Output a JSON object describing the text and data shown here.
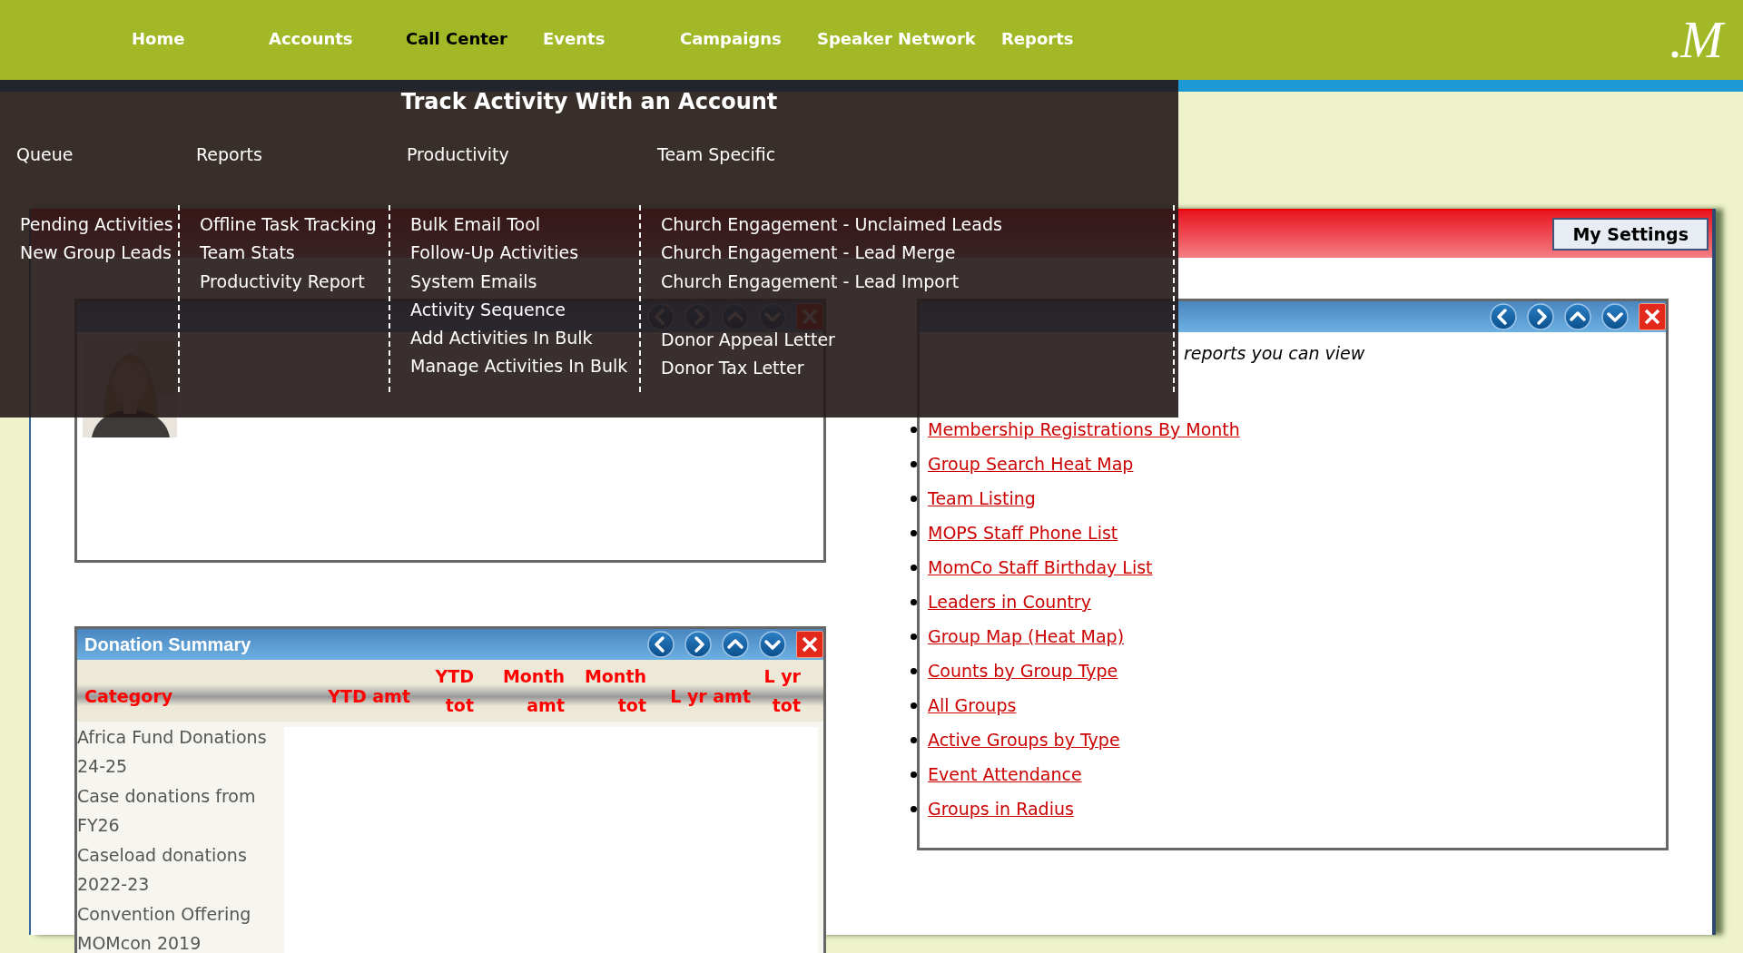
{
  "nav": {
    "items": [
      {
        "label": "Home",
        "selected": false
      },
      {
        "label": "Accounts",
        "selected": false
      },
      {
        "label": "Call Center",
        "selected": true
      },
      {
        "label": "Events",
        "selected": false
      },
      {
        "label": "Campaigns",
        "selected": false
      },
      {
        "label": "Speaker Network",
        "selected": false
      },
      {
        "label": "Reports",
        "selected": false
      }
    ],
    "logo": "M"
  },
  "menu": {
    "title": "Track Activity With an Account",
    "columns": [
      {
        "heading": "Queue",
        "groups": [
          [
            "Pending Activities",
            "New Group Leads"
          ]
        ]
      },
      {
        "heading": "Reports",
        "groups": [
          [
            "Offline Task Tracking",
            "Team Stats",
            "Productivity Report"
          ]
        ]
      },
      {
        "heading": "Productivity",
        "groups": [
          [
            "Bulk Email Tool",
            "Follow-Up Activities",
            "System Emails",
            "Activity Sequence",
            "Add Activities In Bulk",
            "Manage Activities In Bulk"
          ]
        ]
      },
      {
        "heading": "Team Specific",
        "groups": [
          [
            "Church Engagement - Unclaimed Leads",
            "Church Engagement - Lead Merge",
            "Church Engagement - Lead Import"
          ],
          [
            "Donor Appeal Letter",
            "Donor Tax Letter"
          ]
        ]
      }
    ]
  },
  "dashboard": {
    "settings_button": "My Settings"
  },
  "report_list": {
    "available_note": "reports you can view",
    "reports": [
      "Membership Registrations By Month",
      "Group Search Heat Map",
      "Team Listing",
      "MOPS Staff Phone List",
      "MomCo Staff Birthday List",
      "Leaders in Country",
      "Group Map (Heat Map)",
      "Counts by Group Type",
      "All Groups",
      "Active Groups by Type",
      "Event Attendance",
      "Groups in Radius"
    ]
  },
  "donation_summary": {
    "title": "Donation Summary",
    "columns": [
      "Category",
      "YTD amt",
      "YTD tot",
      "Month amt",
      "Month tot",
      "L yr amt",
      "L yr tot"
    ],
    "categories": [
      "Africa Fund Donations 24-25",
      "Case donations from FY26",
      "Caseload donations 2022-23",
      "Convention Offering MOMcon 2019"
    ]
  }
}
